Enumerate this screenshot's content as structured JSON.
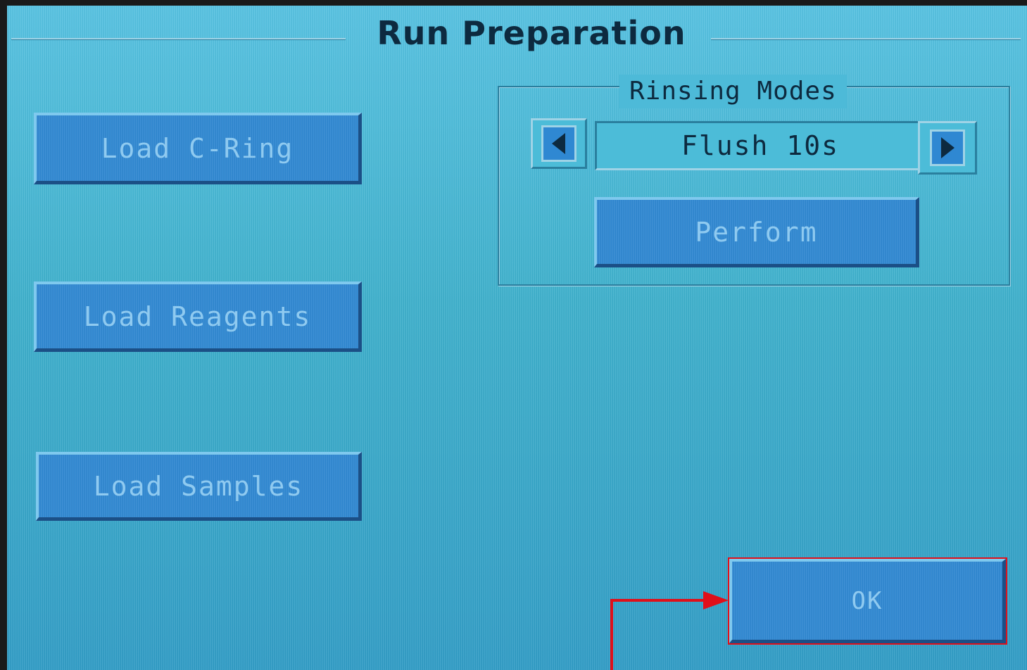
{
  "header": {
    "title": "Run Preparation"
  },
  "actions": {
    "load_c_ring": "Load C-Ring",
    "load_reagents": "Load Reagents",
    "load_samples": "Load Samples"
  },
  "rinsing": {
    "group_label": "Rinsing Modes",
    "current_mode": "Flush 10s",
    "perform_label": "Perform",
    "prev_icon": "triangle-left-icon",
    "next_icon": "triangle-right-icon"
  },
  "footer": {
    "ok_label": "OK"
  },
  "colors": {
    "screen": "#3fb0cf",
    "button": "#2f88d2",
    "text_dark": "#0d2a3f",
    "text_button": "#8fcaf0",
    "highlight": "#e0101a"
  }
}
